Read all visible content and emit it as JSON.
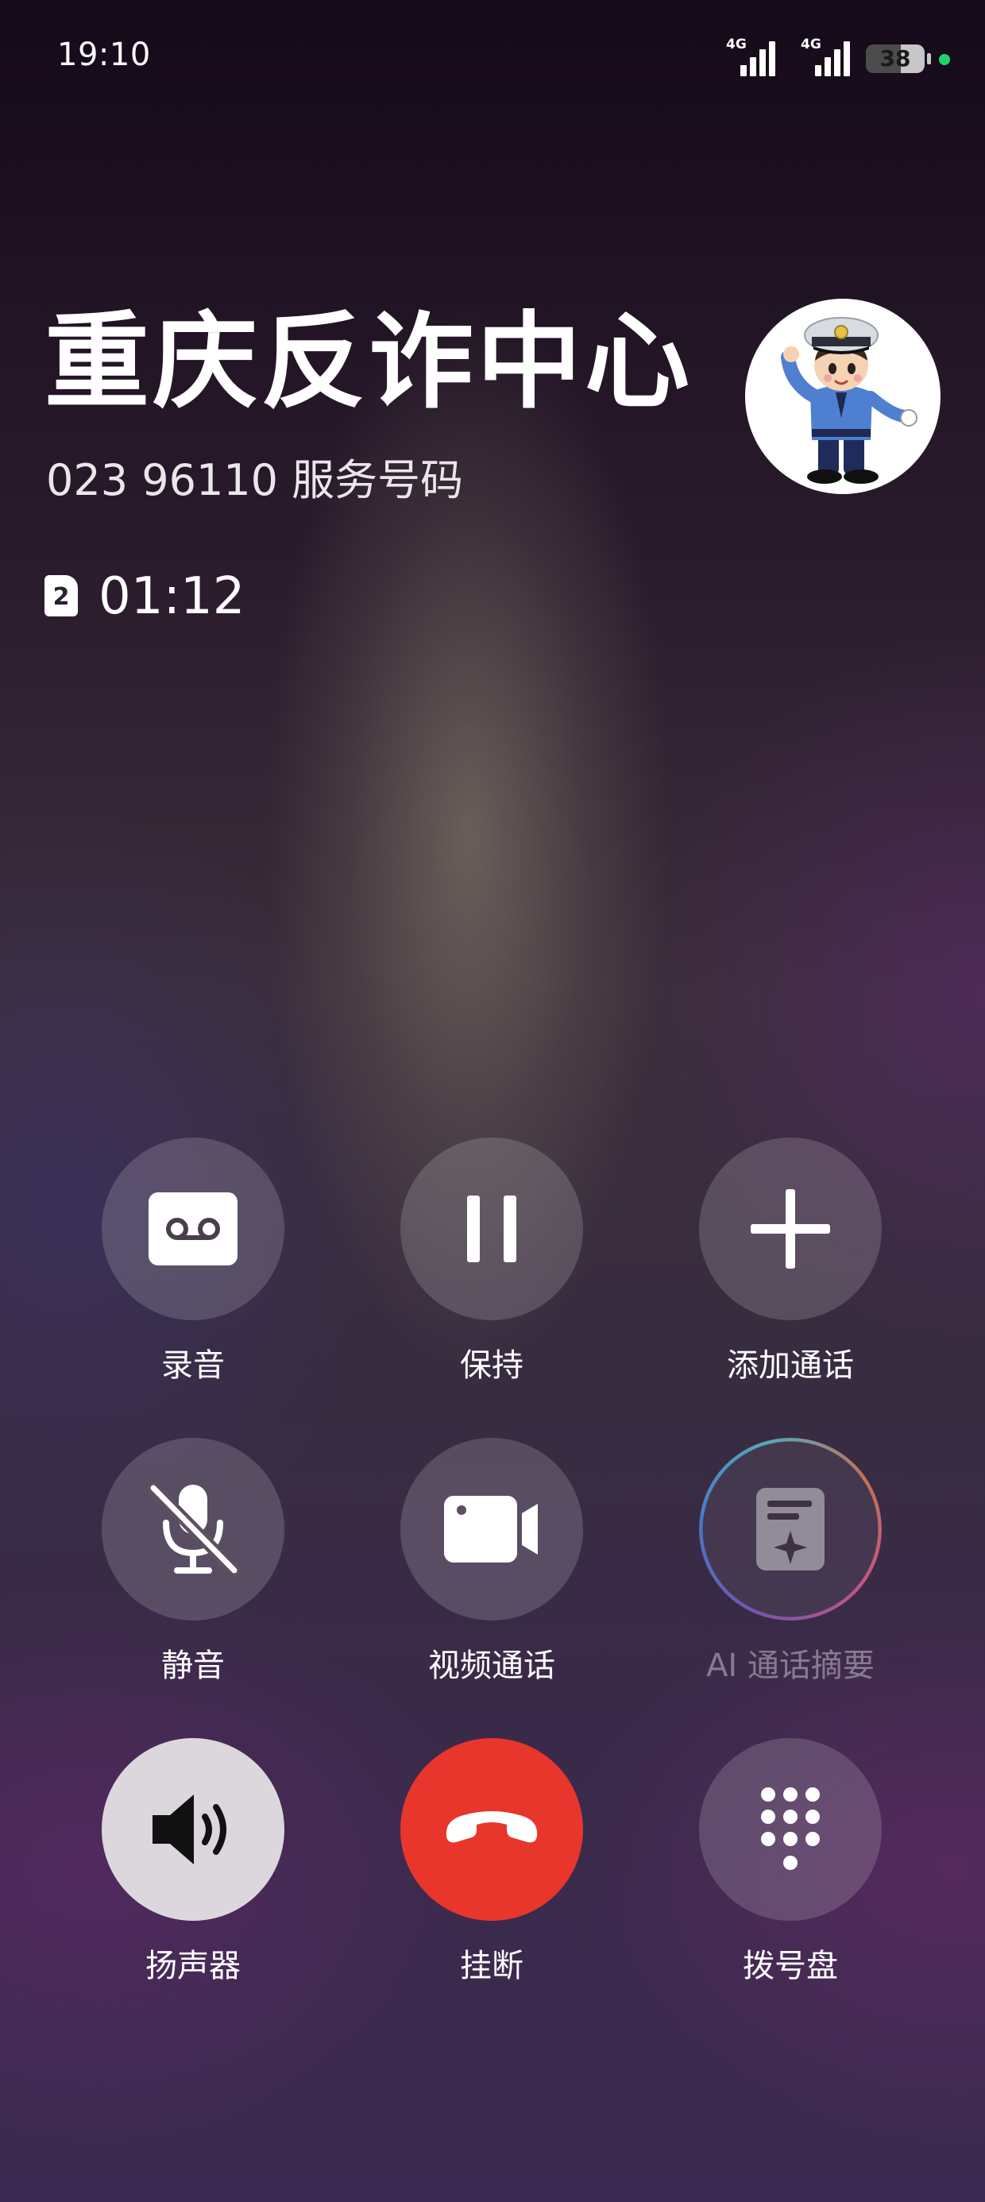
{
  "status_bar": {
    "time": "19:10",
    "sim1_network": "4G",
    "sim2_network": "4G",
    "battery": "38"
  },
  "caller": {
    "name": "重庆反诈中心",
    "subtitle": "023 96110 服务号码",
    "sim_slot": "2",
    "duration": "01:12"
  },
  "actions": [
    {
      "label": "录音",
      "icon": "voicemail-tape-icon"
    },
    {
      "label": "保持",
      "icon": "pause-icon"
    },
    {
      "label": "添加通话",
      "icon": "plus-icon"
    },
    {
      "label": "静音",
      "icon": "mic-off-icon"
    },
    {
      "label": "视频通话",
      "icon": "video-camera-icon"
    },
    {
      "label": "AI 通话摘要",
      "icon": "ai-summary-icon"
    },
    {
      "label": "扬声器",
      "icon": "speaker-icon"
    },
    {
      "label": "挂断",
      "icon": "hang-up-icon"
    },
    {
      "label": "拨号盘",
      "icon": "dialpad-icon"
    }
  ],
  "colors": {
    "hang_up": "#e8362c",
    "speaker_active": "#dcd7dc",
    "charging": "#22d36b"
  }
}
